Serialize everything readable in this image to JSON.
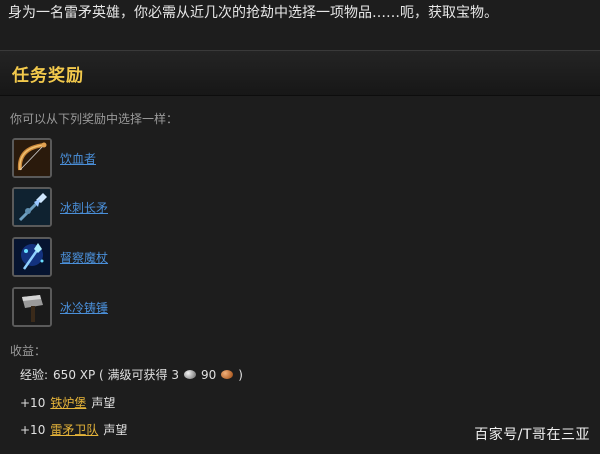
{
  "intro_text": "身为一名雷矛英雄，你必需从近几次的抢劫中选择一项物品……呃，获取宝物。",
  "section_title": "任务奖励",
  "choose_text": "你可以从下列奖励中选择一样：",
  "rewards": [
    {
      "label": "饮血者",
      "icon": "bow-icon"
    },
    {
      "label": "冰刺长矛",
      "icon": "spear-icon"
    },
    {
      "label": "督察魔杖",
      "icon": "wand-icon"
    },
    {
      "label": "冰冷铸锤",
      "icon": "hammer-icon"
    }
  ],
  "gains_label": "收益：",
  "experience": {
    "prefix": "经验:",
    "xp": "650 XP ( 满级可获得 3",
    "copper_amount": "90",
    "suffix": ")"
  },
  "reputation": [
    {
      "amount": "+10",
      "faction": "铁炉堡",
      "suffix": "声望"
    },
    {
      "amount": "+10",
      "faction": "雷矛卫队",
      "suffix": "声望"
    }
  ],
  "watermark": "百家号/T哥在三亚",
  "colors": {
    "title": "#f2c94c",
    "link": "#4a8fd9",
    "faction": "#e7b53a",
    "background": "#1d1d1d"
  }
}
